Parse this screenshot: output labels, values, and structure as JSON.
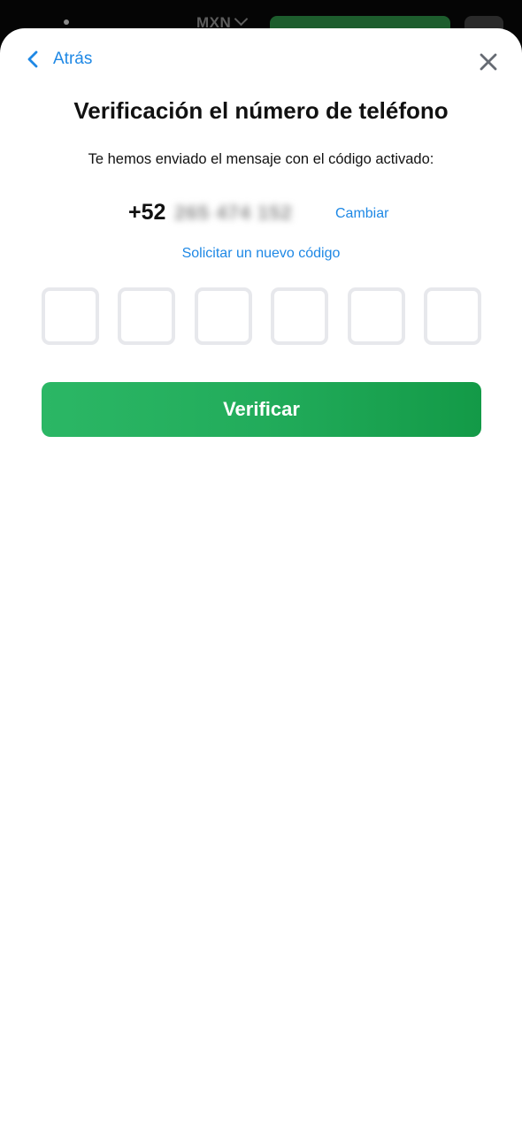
{
  "background": {
    "currency": "MXN"
  },
  "header": {
    "back_label": "Atrás",
    "close_icon": "close-icon",
    "back_icon": "chevron-left-icon"
  },
  "main": {
    "title": "Verificación el número de teléfono",
    "subtitle": "Te hemos enviado el mensaje con el código activado:",
    "phone_code": "+52",
    "phone_number_redacted": "265 474 152",
    "change_label": "Cambiar",
    "resend_label": "Solicitar un nuevo código",
    "code_digits": [
      "",
      "",
      "",
      "",
      "",
      ""
    ],
    "verify_label": "Verificar"
  },
  "colors": {
    "accent_blue": "#1e88e5",
    "button_green": "#22ac5b",
    "box_border": "#e7e8ec"
  }
}
